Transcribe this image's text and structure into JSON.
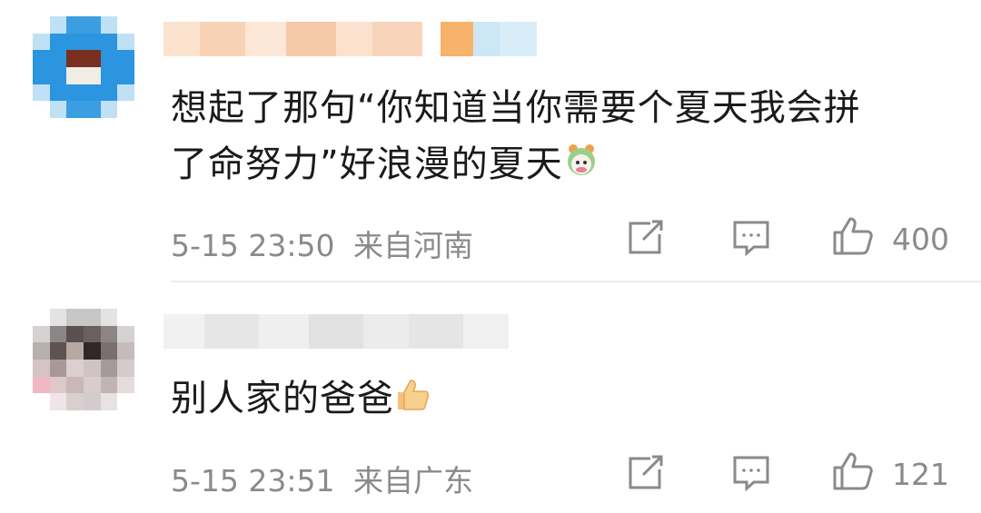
{
  "comments": [
    {
      "text_line1": "想起了那句“你知道当你需要个夏天我会拼",
      "text_line2": "了命努力”好浪漫的夏天",
      "time": "5-15 23:50",
      "location": "来自河南",
      "likes": "400",
      "trailing_icon": "cartoon-emoji-icon"
    },
    {
      "text_line1": "别人家的爸爸",
      "time": "5-15 23:51",
      "location": "来自广东",
      "likes": "121",
      "trailing_icon": "thumbs-up-emoji-icon"
    }
  ],
  "icons": {
    "share": "share-icon",
    "comment": "comment-icon",
    "like": "like-icon"
  },
  "colors": {
    "text": "#1a1a1a",
    "meta": "#8a8a8a",
    "divider": "#ececec"
  }
}
